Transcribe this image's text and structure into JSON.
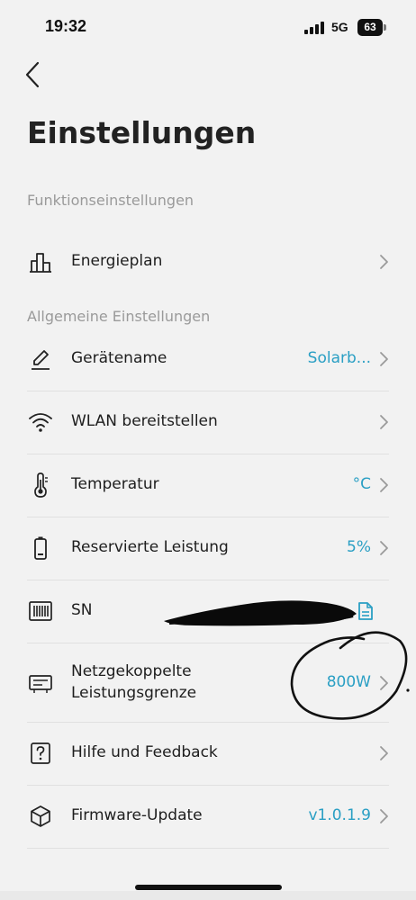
{
  "status": {
    "time": "19:32",
    "network": "5G",
    "battery": "63"
  },
  "header": {
    "title": "Einstellungen"
  },
  "sections": {
    "function_settings": "Funktionseinstellungen",
    "general_settings": "Allgemeine Einstellungen"
  },
  "rows": {
    "energieplan": {
      "label": "Energieplan",
      "icon": "bar-chart-icon"
    },
    "geraetename": {
      "label": "Gerätename",
      "value": "Solarb...",
      "icon": "edit-icon"
    },
    "wlan": {
      "label": "WLAN bereitstellen",
      "icon": "wifi-icon"
    },
    "temperatur": {
      "label": "Temperatur",
      "value": "°C",
      "icon": "thermometer-icon"
    },
    "reserve": {
      "label": "Reservierte Leistung",
      "value": "5%",
      "icon": "battery-icon"
    },
    "sn": {
      "label": "SN",
      "icon": "barcode-icon",
      "action_icon": "copy-icon"
    },
    "netz": {
      "label_line1": "Netzgekoppelte",
      "label_line2": "Leistungsgrenze",
      "value": "800W",
      "icon": "grid-device-icon"
    },
    "hilfe": {
      "label": "Hilfe und Feedback",
      "icon": "help-icon"
    },
    "firmware": {
      "label": "Firmware-Update",
      "value": "v1.0.1.9",
      "icon": "cube-icon"
    }
  },
  "colors": {
    "accent": "#2a9fc4",
    "background": "#f2f2f2",
    "section_text": "#9a9a9a"
  }
}
